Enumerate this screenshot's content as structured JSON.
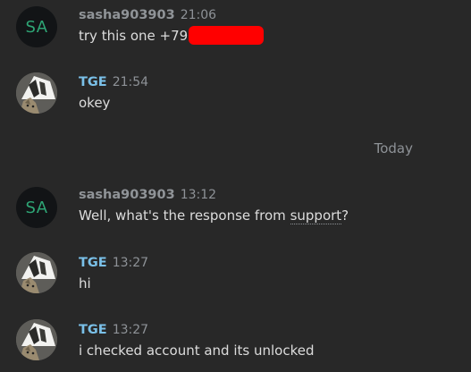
{
  "colors": {
    "background": "#282828",
    "text": "#dcdcdc",
    "muted": "#8e9297",
    "sasha_name": "#909498",
    "tge_name": "#7ac0e8",
    "sa_initials": "#2ea575",
    "redaction": "#ff0000"
  },
  "messages": [
    {
      "author": "sasha903903",
      "avatar_initials": "SA",
      "time": "21:06",
      "text": "try this one +79"
    },
    {
      "author": "TGE",
      "avatar_icon": "cat-photo-icon",
      "time": "21:54",
      "text": "okey"
    },
    {
      "author": "sasha903903",
      "avatar_initials": "SA",
      "time": "13:12",
      "text_before": "Well, what's the response from ",
      "text_link": "support",
      "text_after": "?"
    },
    {
      "author": "TGE",
      "avatar_icon": "cat-photo-icon",
      "time": "13:27",
      "text": "hi"
    },
    {
      "author": "TGE",
      "avatar_icon": "cat-photo-icon",
      "time": "13:27",
      "text": "i checked account and its unlocked"
    }
  ],
  "divider": {
    "label": "Today"
  }
}
